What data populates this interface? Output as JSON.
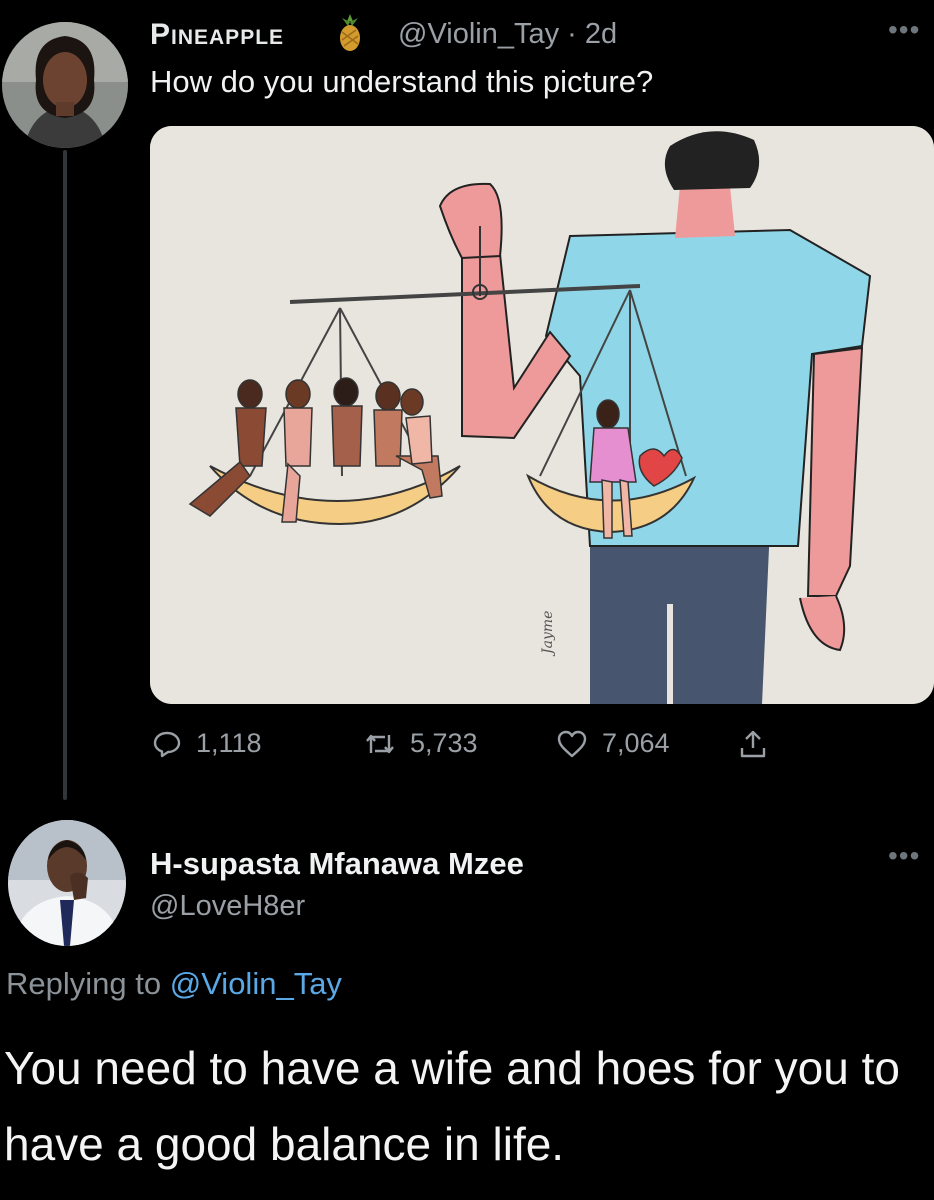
{
  "tweet": {
    "author_name": "Pineapple",
    "author_emoji_icon": "pineapple-icon",
    "handle_time": "@Violin_Tay · 2d",
    "text": "How do you understand this picture?",
    "more_label": "•••",
    "media": {
      "signature": "Jayme"
    },
    "stats": {
      "replies": "1,118",
      "retweets": "5,733",
      "likes": "7,064"
    }
  },
  "reply": {
    "author_name": "H-supasta Mfanawa Mzee",
    "handle": "@LoveH8er",
    "more_label": "•••",
    "replying_prefix": "Replying to ",
    "replying_handle": "@Violin_Tay",
    "text": "You need to have a wife and hoes for you to have a good balance in life."
  },
  "colors": {
    "background": "#000000",
    "link": "#5aa8e6",
    "muted": "#9aa0a6"
  }
}
